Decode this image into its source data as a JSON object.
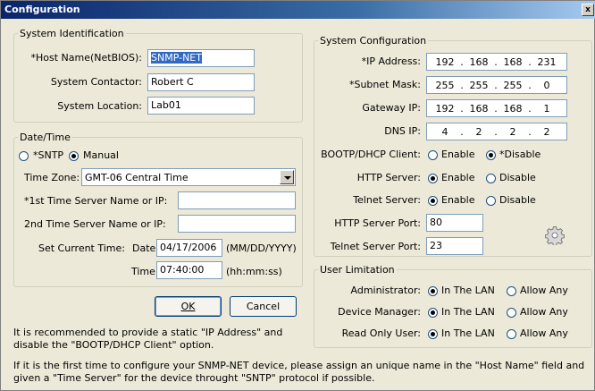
{
  "window": {
    "title": "Configuration",
    "close_glyph": "x"
  },
  "system_identification": {
    "legend": "System Identification",
    "host_name_label": "*Host Name(NetBIOS):",
    "host_name_value": "SNMP-NET",
    "contactor_label": "System Contactor:",
    "contactor_value": "Robert C",
    "location_label": "System Location:",
    "location_value": "Lab01"
  },
  "date_time": {
    "legend": "Date/Time",
    "sntp_label": "*SNTP",
    "manual_label": "Manual",
    "mode_selected": "Manual",
    "time_zone_label": "Time Zone:",
    "time_zone_value": "GMT-06 Central Time",
    "server1_label": "*1st Time Server Name or IP:",
    "server1_value": "",
    "server2_label": "2nd Time Server Name or IP:",
    "server2_value": "",
    "set_current_label": "Set Current Time:",
    "date_label": "Date",
    "date_value": "04/17/2006",
    "date_format": "(MM/DD/YYYY)",
    "time_label": "Time",
    "time_value": "07:40:00",
    "time_format": "(hh:mm:ss)"
  },
  "buttons": {
    "ok_label": "OK",
    "cancel_label": "Cancel"
  },
  "note_static_ip": "It is recommended to provide a static \"IP Address\" and disable the \"BOOTP/DHCP Client\" option.",
  "system_configuration": {
    "legend": "System Configuration",
    "ip_label": "*IP Address:",
    "ip": [
      "192",
      "168",
      "168",
      "231"
    ],
    "subnet_label": "*Subnet Mask:",
    "subnet": [
      "255",
      "255",
      "255",
      "0"
    ],
    "gateway_label": "Gateway IP:",
    "gateway": [
      "192",
      "168",
      "168",
      "1"
    ],
    "dns_label": "DNS IP:",
    "dns": [
      "4",
      "2",
      "2",
      "2"
    ],
    "dot": ".",
    "bootp_label": "BOOTP/DHCP Client:",
    "bootp_enable": "Enable",
    "bootp_disable": "*Disable",
    "bootp_selected": "*Disable",
    "http_label": "HTTP Server:",
    "http_enable": "Enable",
    "http_disable": "Disable",
    "http_selected": "Enable",
    "telnet_label": "Telnet Server:",
    "telnet_enable": "Enable",
    "telnet_disable": "Disable",
    "telnet_selected": "Enable",
    "http_port_label": "HTTP Server Port:",
    "http_port_value": "80",
    "telnet_port_label": "Telnet Server Port:",
    "telnet_port_value": "23",
    "settings_icon": "gear-icon"
  },
  "user_limitation": {
    "legend": "User Limitation",
    "in_lan_label": "In The LAN",
    "allow_any_label": "Allow Any",
    "rows": [
      {
        "label": "Administrator:",
        "selected": "In The LAN"
      },
      {
        "label": "Device Manager:",
        "selected": "In The LAN"
      },
      {
        "label": "Read Only User:",
        "selected": "In The LAN"
      }
    ]
  },
  "note_first_time": "If it is the first time to configure your SNMP-NET device, please assign an unique name in the \"Host Name\" field and given a \"Time Server\" for the device throught \"SNTP\" protocol if possible.",
  "colors": {
    "dialog_bg": "#ece9d8",
    "title_bar": "#0a246a",
    "selection": "#316ac5",
    "group_border": "#d0d0bf"
  }
}
